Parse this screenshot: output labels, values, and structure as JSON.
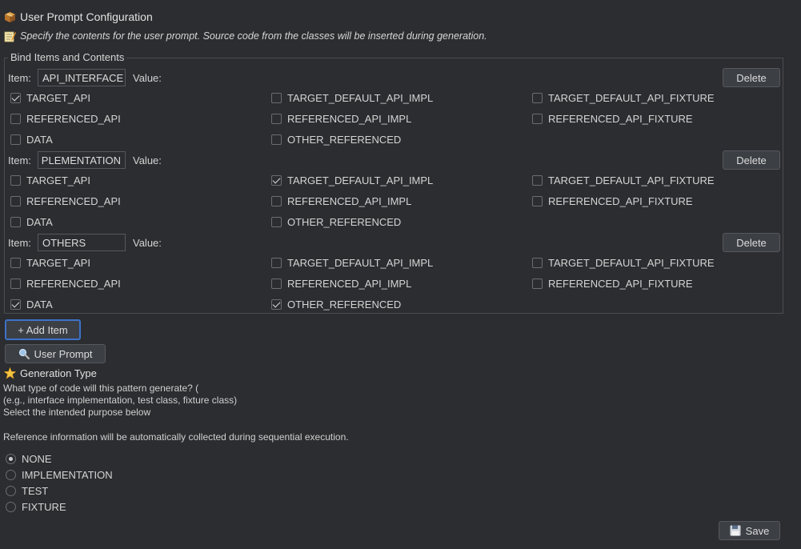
{
  "header": {
    "title": "User Prompt Configuration",
    "description": "Specify the contents for the user prompt. Source code from the classes will be inserted during generation."
  },
  "bind_section": {
    "legend": "Bind Items and Contents",
    "item_label": "Item:",
    "value_label": "Value:",
    "delete_label": "Delete",
    "items": [
      {
        "name": "API_INTERFACE",
        "options": [
          {
            "label": "TARGET_API",
            "checked": true
          },
          {
            "label": "TARGET_DEFAULT_API_IMPL",
            "checked": false
          },
          {
            "label": "TARGET_DEFAULT_API_FIXTURE",
            "checked": false
          },
          {
            "label": "REFERENCED_API",
            "checked": false
          },
          {
            "label": "REFERENCED_API_IMPL",
            "checked": false
          },
          {
            "label": "REFERENCED_API_FIXTURE",
            "checked": false
          },
          {
            "label": "DATA",
            "checked": false
          },
          {
            "label": "OTHER_REFERENCED",
            "checked": false
          }
        ]
      },
      {
        "name": "PLEMENTATION",
        "options": [
          {
            "label": "TARGET_API",
            "checked": false
          },
          {
            "label": "TARGET_DEFAULT_API_IMPL",
            "checked": true
          },
          {
            "label": "TARGET_DEFAULT_API_FIXTURE",
            "checked": false
          },
          {
            "label": "REFERENCED_API",
            "checked": false
          },
          {
            "label": "REFERENCED_API_IMPL",
            "checked": false
          },
          {
            "label": "REFERENCED_API_FIXTURE",
            "checked": false
          },
          {
            "label": "DATA",
            "checked": false
          },
          {
            "label": "OTHER_REFERENCED",
            "checked": false
          }
        ]
      },
      {
        "name": "OTHERS",
        "options": [
          {
            "label": "TARGET_API",
            "checked": false
          },
          {
            "label": "TARGET_DEFAULT_API_IMPL",
            "checked": false
          },
          {
            "label": "TARGET_DEFAULT_API_FIXTURE",
            "checked": false
          },
          {
            "label": "REFERENCED_API",
            "checked": false
          },
          {
            "label": "REFERENCED_API_IMPL",
            "checked": false
          },
          {
            "label": "REFERENCED_API_FIXTURE",
            "checked": false
          },
          {
            "label": "DATA",
            "checked": true
          },
          {
            "label": "OTHER_REFERENCED",
            "checked": true
          }
        ]
      }
    ]
  },
  "add_item_label": "+ Add Item",
  "user_prompt_label": "User Prompt",
  "generation": {
    "title": "Generation Type",
    "line1": "What type of code will this pattern generate? (",
    "line2": "(e.g., interface implementation, test class, fixture class)",
    "line3": "Select the intended purpose below",
    "note": "Reference information will be automatically collected during sequential execution.",
    "options": [
      {
        "label": "NONE",
        "selected": true
      },
      {
        "label": "IMPLEMENTATION",
        "selected": false
      },
      {
        "label": "TEST",
        "selected": false
      },
      {
        "label": "FIXTURE",
        "selected": false
      }
    ]
  },
  "save_label": "Save",
  "icons": {
    "title": "package-icon",
    "description": "memo-icon",
    "user_prompt": "magnifier-icon",
    "generation": "star-icon",
    "save": "floppy-disk-icon"
  },
  "colors": {
    "background": "#2b2d30",
    "accent_focus": "#3d72c9"
  }
}
